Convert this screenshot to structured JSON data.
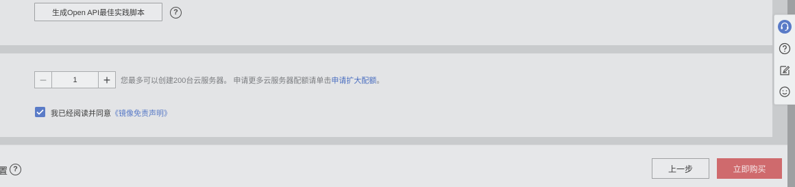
{
  "top_section": {
    "script_button_label": "生成Open API最佳实践脚本",
    "help_icon": "question-circle-icon"
  },
  "quantity_section": {
    "decrement_symbol": "−",
    "increment_symbol": "+",
    "value": "1",
    "quota_text_prefix": "您最多可以创建200台云服务器。 申请更多云服务器配额请单击",
    "quota_link": "申请扩大配额",
    "quota_text_suffix": "。"
  },
  "agreement": {
    "checked": true,
    "text_prefix": "我已经阅读并同意",
    "link": "《镜像免责声明》"
  },
  "footer": {
    "left_char": "置",
    "prev_button_label": "上一步",
    "buy_button_label": "立即购买",
    "buy_button_color": "#cf6a6d"
  },
  "float_toolbar": {
    "icons": [
      "headset-support-icon",
      "help-icon",
      "edit-feedback-icon",
      "smile-icon"
    ],
    "accent_color": "#5a7bc7"
  }
}
